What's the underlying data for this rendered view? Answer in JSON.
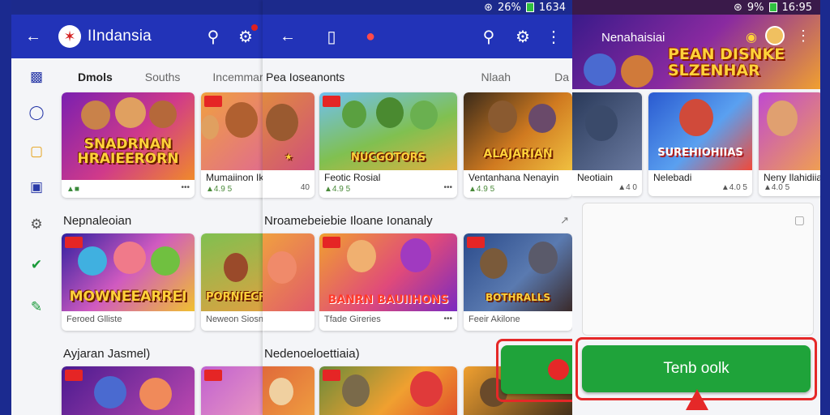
{
  "left": {
    "title": "IIndansia",
    "tabs": [
      "Dmols",
      "Souths",
      "Incemmar"
    ],
    "sections": [
      {
        "title": "Nepnaleoian"
      },
      {
        "title": "Ayjaran Jasmel)"
      }
    ],
    "cards": [
      {
        "name": "",
        "meta": "",
        "more": "•••",
        "logo": "SNADRNAN HRAIEERORN"
      },
      {
        "name": "Mumaiinon Ikulm",
        "meta": "▲4.9 5",
        "more": "",
        "logo": "FPOAVIVS"
      },
      {
        "name": "Feroed Glliste",
        "meta": "",
        "more": "",
        "logo": "MOWNEEARREI"
      },
      {
        "name": "Neweon Siosne",
        "meta": "",
        "more": "",
        "logo": "PORNIECRAS"
      },
      {
        "name": "",
        "meta": "",
        "more": "",
        "logo": ""
      },
      {
        "name": "",
        "meta": "",
        "more": "",
        "logo": ""
      }
    ]
  },
  "mid": {
    "title": "Pea Ioseanonts",
    "tab_right": "Nlaah",
    "tab_far": "Da",
    "sections": [
      {
        "title": "Nroamebeiebie Iloane Ionanaly"
      },
      {
        "title": "Nedenoeloettiaia)"
      }
    ],
    "cards": [
      {
        "name": "Feotic Rosial",
        "meta": "▲4.9 5",
        "more": "•••",
        "logo": "NUCGOTORS"
      },
      {
        "name": "Ventanhana Nenayin",
        "meta": "▲4.9 5",
        "more": "",
        "logo": "ALAJARIAN"
      },
      {
        "name": "Tfade Gireries",
        "meta": "",
        "more": "•••",
        "logo": "BANRN BAUIIHONS"
      },
      {
        "name": "Feeir Akilone",
        "meta": "",
        "more": "",
        "logo": "BOTHRALLS"
      }
    ],
    "partial_price": "40"
  },
  "right": {
    "header_title": "Nenahaisiai",
    "banner_text": "PEAN DISNKE SLZENHAR",
    "cards": [
      {
        "name": "Neotiain",
        "meta": "▲4 0",
        "more": "",
        "logo": ""
      },
      {
        "name": "Nelebadi",
        "meta": "▲4.0 5",
        "more": "•••",
        "logo": "SUREHIOHIIAS"
      },
      {
        "name": "Neny Ilahidiian",
        "meta": "▲4.0 5",
        "more": "",
        "logo": ""
      }
    ],
    "button_label": "Tenb oolk"
  },
  "status": {
    "left_time": "1634",
    "right_time": "16:95",
    "left_batt": "26%",
    "right_batt": "9%"
  }
}
